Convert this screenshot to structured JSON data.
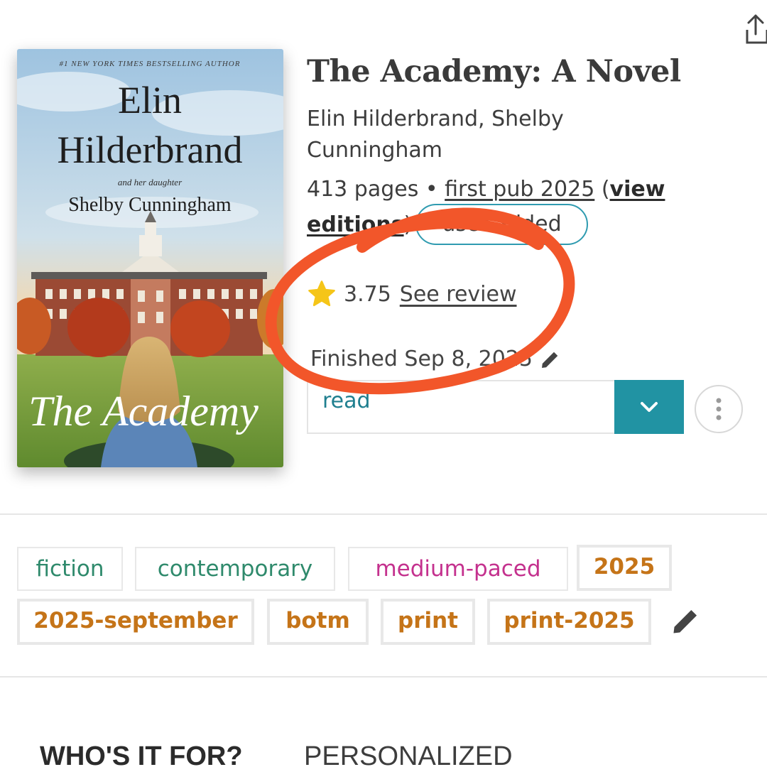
{
  "book": {
    "title": "The Academy: A Novel",
    "authors": "Elin Hilderbrand, Shelby Cunningham",
    "pages": "413 pages",
    "separator": " • ",
    "first_pub": "first pub 2025",
    "open_paren": " (",
    "view_editions": "view editions",
    "close_paren": ")",
    "user_added_badge": "user-added"
  },
  "cover": {
    "banner": "#1 NEW YORK TIMES BESTSELLING AUTHOR",
    "author_first": "Elin",
    "author_last": "Hilderbrand",
    "and_line": "and her daughter",
    "coauthor": "Shelby Cunningham",
    "title": "The Academy"
  },
  "rating": {
    "value": "3.75",
    "see_review": "See review",
    "star_color": "#f5c518"
  },
  "reading": {
    "finished": "Finished Sep 8, 2025",
    "status": "read"
  },
  "tags": [
    {
      "label": "fiction",
      "color": "#2f8a6c"
    },
    {
      "label": "contemporary",
      "color": "#2f8a6c"
    },
    {
      "label": "medium-paced",
      "color": "#c4318e"
    },
    {
      "label": "2025",
      "color": "#c57418"
    },
    {
      "label": "2025-september",
      "color": "#c57418"
    },
    {
      "label": "botm",
      "color": "#c57418"
    },
    {
      "label": "print",
      "color": "#c57418"
    },
    {
      "label": "print-2025",
      "color": "#c57418"
    }
  ],
  "sections": {
    "whos_it_for": "WHO'S IT FOR?",
    "personalized": "PERSONALIZED"
  },
  "icons": {
    "share": "share-icon",
    "star": "star-icon",
    "edit": "pencil-icon",
    "dropdown": "chevron-down-icon",
    "more": "more-vertical-icon"
  },
  "colors": {
    "accent": "#2193a3",
    "annotation": "#f2562a"
  }
}
